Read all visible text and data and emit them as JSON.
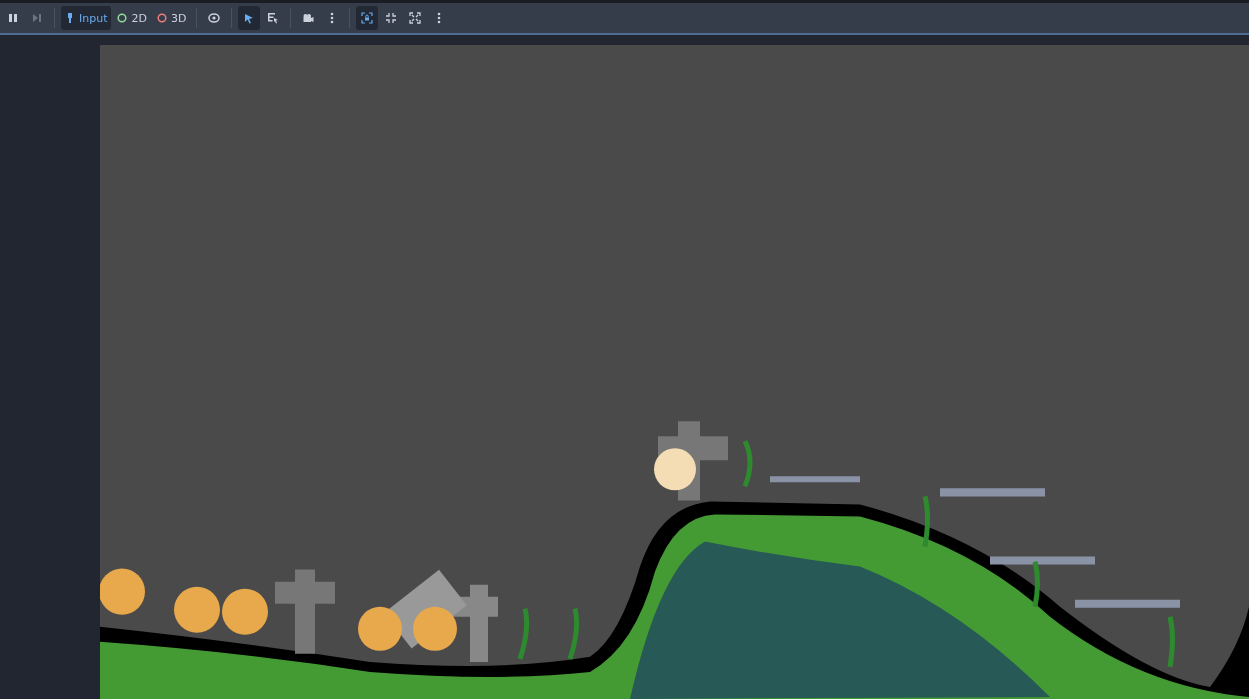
{
  "toolbar": {
    "groups": [
      [
        {
          "kind": "pause",
          "selected": false,
          "disabled": false
        },
        {
          "kind": "next-frame",
          "selected": false,
          "disabled": true
        }
      ],
      [
        {
          "kind": "input",
          "label": "Input",
          "selected": true,
          "disabled": false
        },
        {
          "kind": "twod",
          "label": "2D",
          "selected": false,
          "disabled": false
        },
        {
          "kind": "threed",
          "label": "3D",
          "selected": false,
          "disabled": false
        }
      ],
      [
        {
          "kind": "eye",
          "selected": false,
          "disabled": false
        }
      ],
      [
        {
          "kind": "select",
          "selected": true,
          "disabled": false
        },
        {
          "kind": "list",
          "selected": false,
          "disabled": false
        }
      ],
      [
        {
          "kind": "camera",
          "selected": false,
          "disabled": false
        },
        {
          "kind": "more",
          "selected": false,
          "disabled": false
        }
      ],
      [
        {
          "kind": "lock",
          "selected": true,
          "disabled": false
        },
        {
          "kind": "shrink",
          "selected": false,
          "disabled": false
        },
        {
          "kind": "expand",
          "selected": false,
          "disabled": false
        },
        {
          "kind": "more",
          "selected": false,
          "disabled": false
        }
      ]
    ]
  }
}
